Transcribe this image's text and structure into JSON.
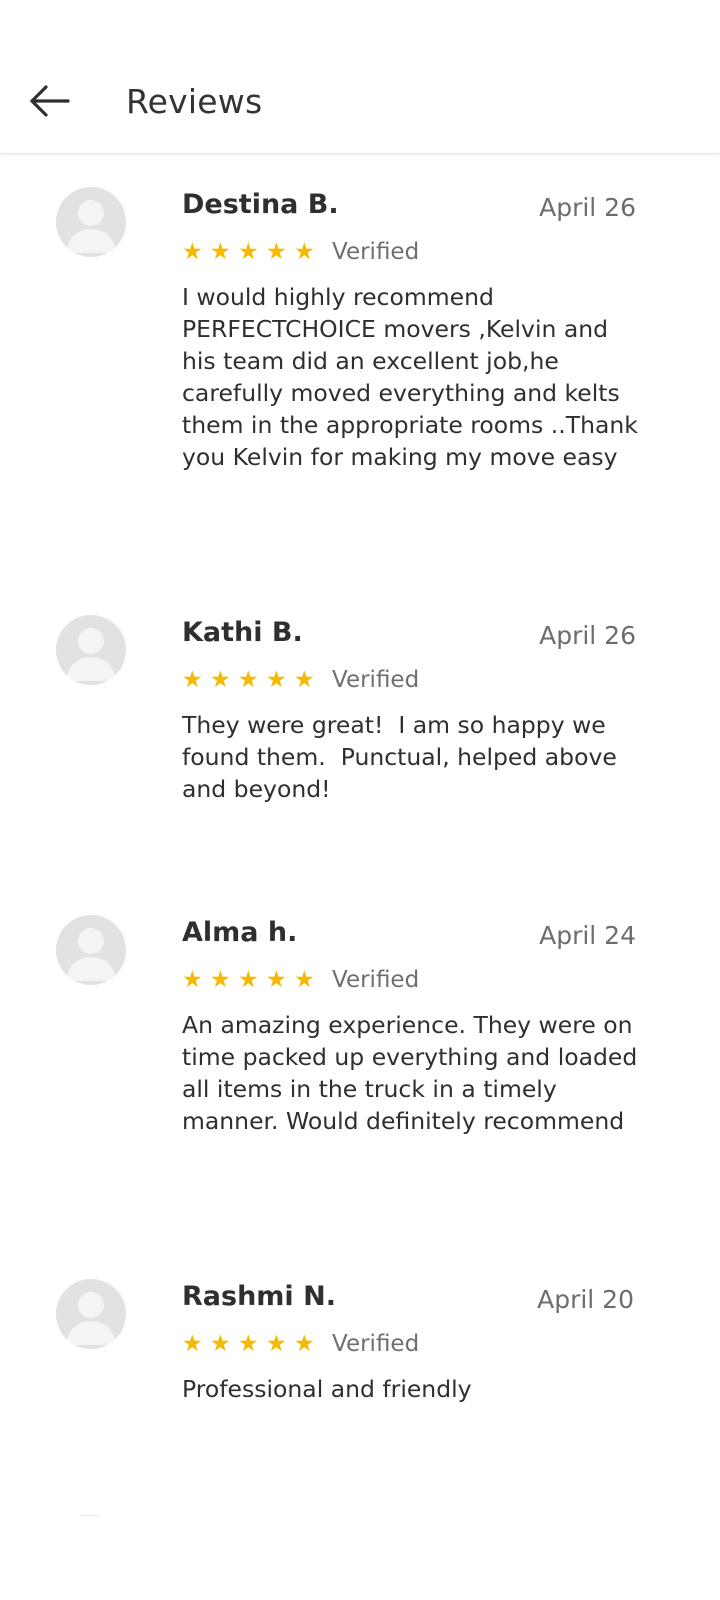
{
  "header": {
    "title": "Reviews",
    "back_icon": "arrow-left-icon"
  },
  "colors": {
    "star": "#f7b900",
    "avatar_bg": "#e2e2e2",
    "divider": "#e6e6e6"
  },
  "reviews": [
    {
      "name": "Destina B.",
      "date": "April 26",
      "rating": 5,
      "verified_label": "Verified",
      "text": "I would highly recommend PERFECTCHOICE movers ,Kelvin and his team did an excellent job,he carefully moved everything and kelts them in the appropriate rooms ..Thank you Kelvin for making my move easy"
    },
    {
      "name": "Kathi B.",
      "date": "April 26",
      "rating": 5,
      "verified_label": "Verified",
      "text": "They were great!  I am so happy we found them.  Punctual, helped above and beyond!"
    },
    {
      "name": "Alma h.",
      "date": "April 24",
      "rating": 5,
      "verified_label": "Verified",
      "text": "An amazing experience. They were on time packed up everything and loaded all items in the truck in a timely manner. Would definitely recommend"
    },
    {
      "name": "Rashmi N.",
      "date": "April 20",
      "rating": 5,
      "verified_label": "Verified",
      "text": "Professional and friendly"
    }
  ]
}
